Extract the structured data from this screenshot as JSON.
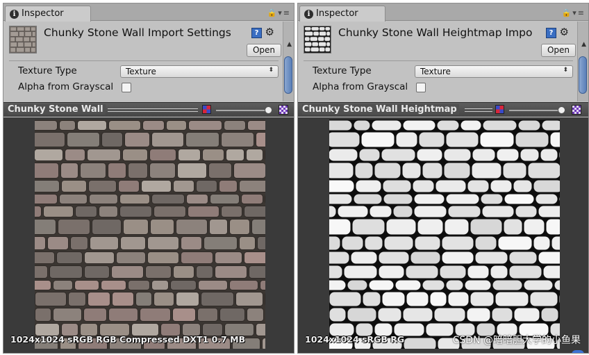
{
  "inspectors": [
    {
      "tab_label": "Inspector",
      "title": "Chunky Stone Wall Import Settings",
      "open_label": "Open",
      "texture_type_label": "Texture Type",
      "texture_type_value": "Texture",
      "alpha_label": "Alpha from Grayscal",
      "alpha_checked": false,
      "preview_title": "Chunky Stone Wall",
      "info_text": "1024x1024 sRGB  RGB Compressed DXT1   0.7 MB",
      "texture_kind": "color"
    },
    {
      "tab_label": "Inspector",
      "title": "Chunky Stone Wall Heightmap Impo",
      "open_label": "Open",
      "texture_type_label": "Texture Type",
      "texture_type_value": "Texture",
      "alpha_label": "Alpha from Grayscal",
      "alpha_checked": false,
      "preview_title": "Chunky Stone Wall Heightmap",
      "info_text": "1024x1024 sRGB  RG",
      "texture_kind": "heightmap"
    }
  ],
  "watermark": "CSDN @暗暗胆大学的小鱼果",
  "icons": {
    "info": "info-icon",
    "lock": "lock-icon",
    "menu": "menu-icon",
    "help": "help-icon",
    "gear": "gear-icon",
    "dropdown": "dropdown-arrows-icon",
    "mip": "mip-icon",
    "checker": "checker-icon"
  },
  "colors": {
    "panel_bg": "#c2c2c2",
    "preview_bg": "#3a3a3a",
    "preview_header": "#505050",
    "help_blue": "#3a6ec2"
  }
}
